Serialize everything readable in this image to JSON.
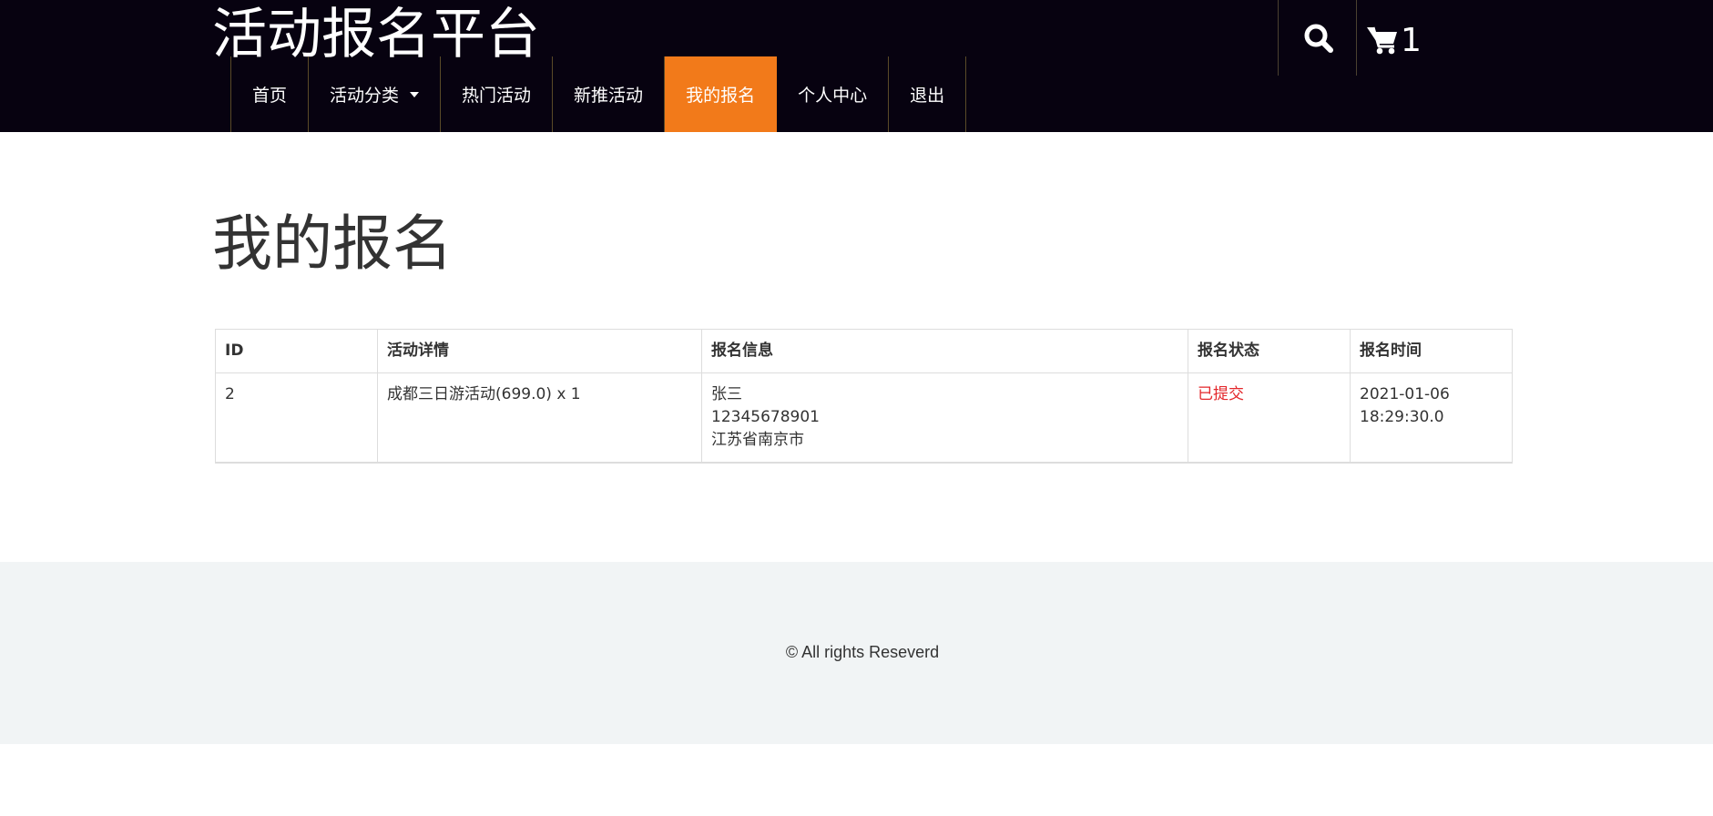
{
  "header": {
    "brand": "活动报名平台",
    "nav": [
      {
        "label": "首页"
      },
      {
        "label": "活动分类"
      },
      {
        "label": "热门活动"
      },
      {
        "label": "新推活动"
      },
      {
        "label": "我的报名"
      },
      {
        "label": "个人中心"
      },
      {
        "label": "退出"
      }
    ],
    "active_nav": "我的报名",
    "cart_count": "1",
    "icons": {
      "search": "search-icon",
      "cart": "cart-icon",
      "dropdown": "caret-down-icon"
    }
  },
  "main": {
    "title": "我的报名",
    "table": {
      "columns": [
        "ID",
        "活动详情",
        "报名信息",
        "报名状态",
        "报名时间"
      ],
      "rows": [
        {
          "id": "2",
          "detail": "成都三日游活动(699.0) x 1",
          "info_name": "张三",
          "info_phone": "12345678901",
          "info_address": "江苏省南京市",
          "status": "已提交",
          "time_date": "2021-01-06",
          "time_clock": "18:29:30.0"
        }
      ]
    }
  },
  "footer": {
    "copyright": "© All rights Reseverd"
  },
  "colors": {
    "header_bg": "#070210",
    "accent": "#f27a1a",
    "status_submitted": "#e3262a",
    "footer_bg": "#f1f4f5"
  }
}
